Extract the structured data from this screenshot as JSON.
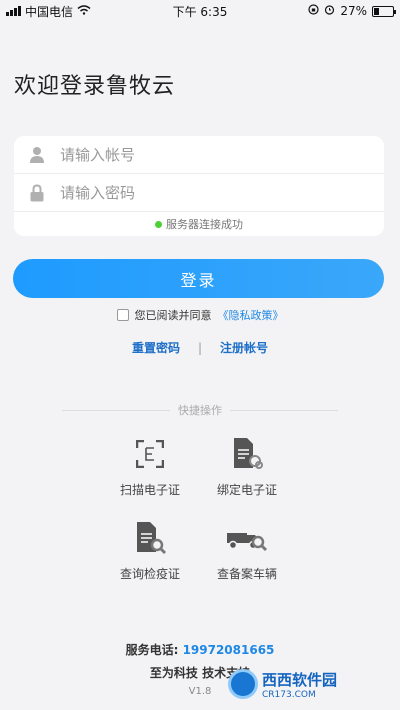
{
  "status_bar": {
    "carrier": "中国电信",
    "time": "下午 6:35",
    "battery": "27%",
    "battery_level": 0.27
  },
  "page": {
    "title": "欢迎登录鲁牧云"
  },
  "form": {
    "account_placeholder": "请输入帐号",
    "password_placeholder": "请输入密码",
    "server_status": "服务器连接成功",
    "server_status_color": "#4cd137"
  },
  "login_button": {
    "label": "登录",
    "color": "#1e9bff"
  },
  "agreement": {
    "text": "您已阅读并同意",
    "policy_link": "《隐私政策》"
  },
  "links": {
    "reset_password": "重置密码",
    "separator": "|",
    "register": "注册帐号"
  },
  "quick": {
    "title": "快捷操作",
    "items": [
      {
        "label": "扫描电子证",
        "icon": "scan-frame-icon"
      },
      {
        "label": "绑定电子证",
        "icon": "document-link-icon"
      },
      {
        "label": "查询检疫证",
        "icon": "document-search-icon"
      },
      {
        "label": "查备案车辆",
        "icon": "truck-search-icon"
      }
    ]
  },
  "footer": {
    "phone_label": "服务电话:",
    "phone_number": "19972081665",
    "support": "至为科技 技术支持",
    "version": "V1.8"
  },
  "watermark": {
    "main": "西西软件园",
    "sub": "CR173.COM"
  }
}
